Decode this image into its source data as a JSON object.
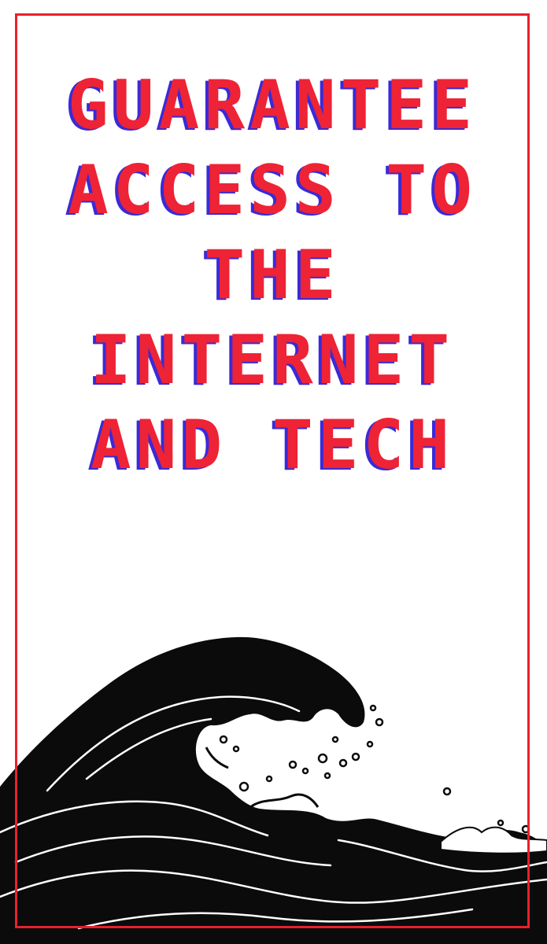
{
  "poster": {
    "headline_lines": [
      "GUARANTEE",
      "ACCESS TO",
      "THE",
      "INTERNET",
      "AND TECH"
    ]
  },
  "colors": {
    "frame": "#e8202f",
    "text": "#ee2335",
    "text_shadow": "#3a2ad8",
    "wave": "#0b0b0b",
    "wave_lines": "#ffffff",
    "background": "#ffffff"
  },
  "illustration": {
    "icon": "ocean-wave-icon"
  }
}
